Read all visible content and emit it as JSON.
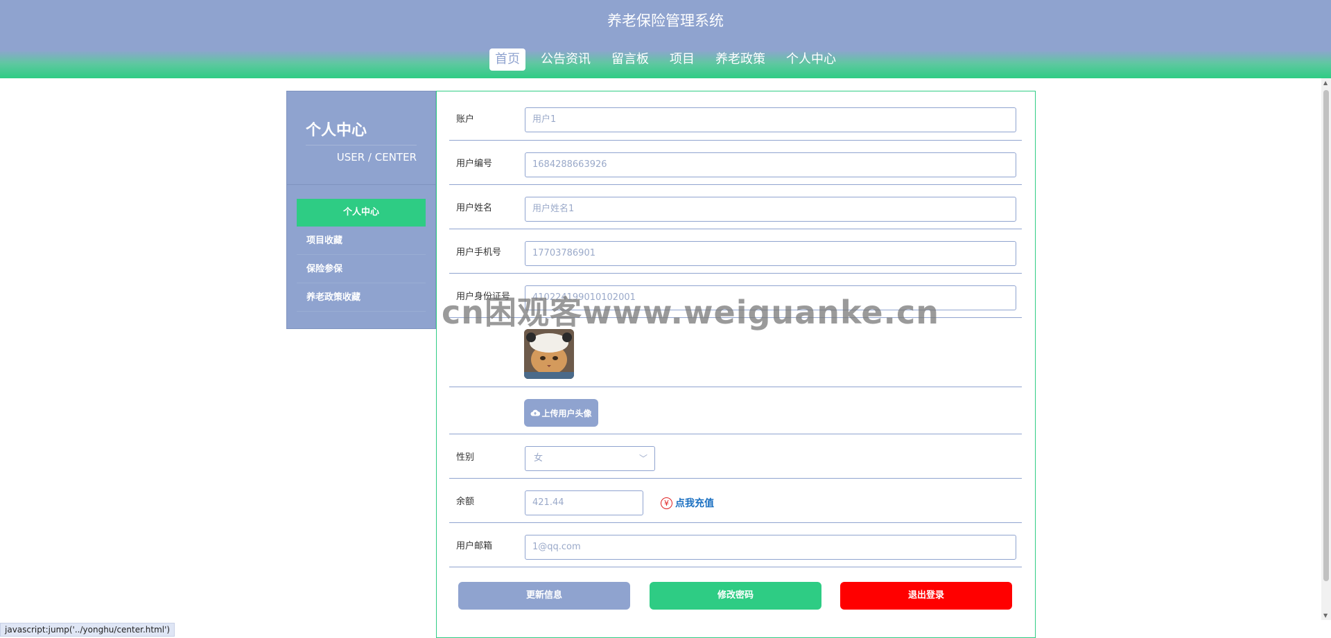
{
  "header": {
    "title": "养老保险管理系统",
    "nav": [
      {
        "label": "首页",
        "active": true
      },
      {
        "label": "公告资讯"
      },
      {
        "label": "留言板"
      },
      {
        "label": "项目"
      },
      {
        "label": "养老政策"
      },
      {
        "label": "个人中心"
      }
    ]
  },
  "sidebar": {
    "title": "个人中心",
    "subtitle": "USER / CENTER",
    "items": [
      {
        "label": "个人中心",
        "active": true
      },
      {
        "label": "项目收藏"
      },
      {
        "label": "保险参保"
      },
      {
        "label": "养老政策收藏"
      }
    ]
  },
  "form": {
    "account_label": "账户",
    "account_value": "用户1",
    "user_no_label": "用户编号",
    "user_no_value": "1684288663926",
    "name_label": "用户姓名",
    "name_value": "用户姓名1",
    "phone_label": "用户手机号",
    "phone_value": "17703786901",
    "idcard_label": "用户身份证号",
    "idcard_value": "410224199010102001",
    "upload_label": "上传用户头像",
    "gender_label": "性别",
    "gender_value": "女",
    "balance_label": "余额",
    "balance_value": "421.44",
    "recharge_label": "点我充值",
    "email_label": "用户邮箱",
    "email_value": "1@qq.com"
  },
  "buttons": {
    "update": "更新信息",
    "change_password": "修改密码",
    "logout": "退出登录"
  },
  "colors": {
    "primary": "#8fa3cf",
    "accent": "#2ecc84",
    "danger": "#ff0000"
  },
  "watermark": "cn困观客www.weiguanke.cn",
  "status_bar": "javascript:jump('../yonghu/center.html')"
}
